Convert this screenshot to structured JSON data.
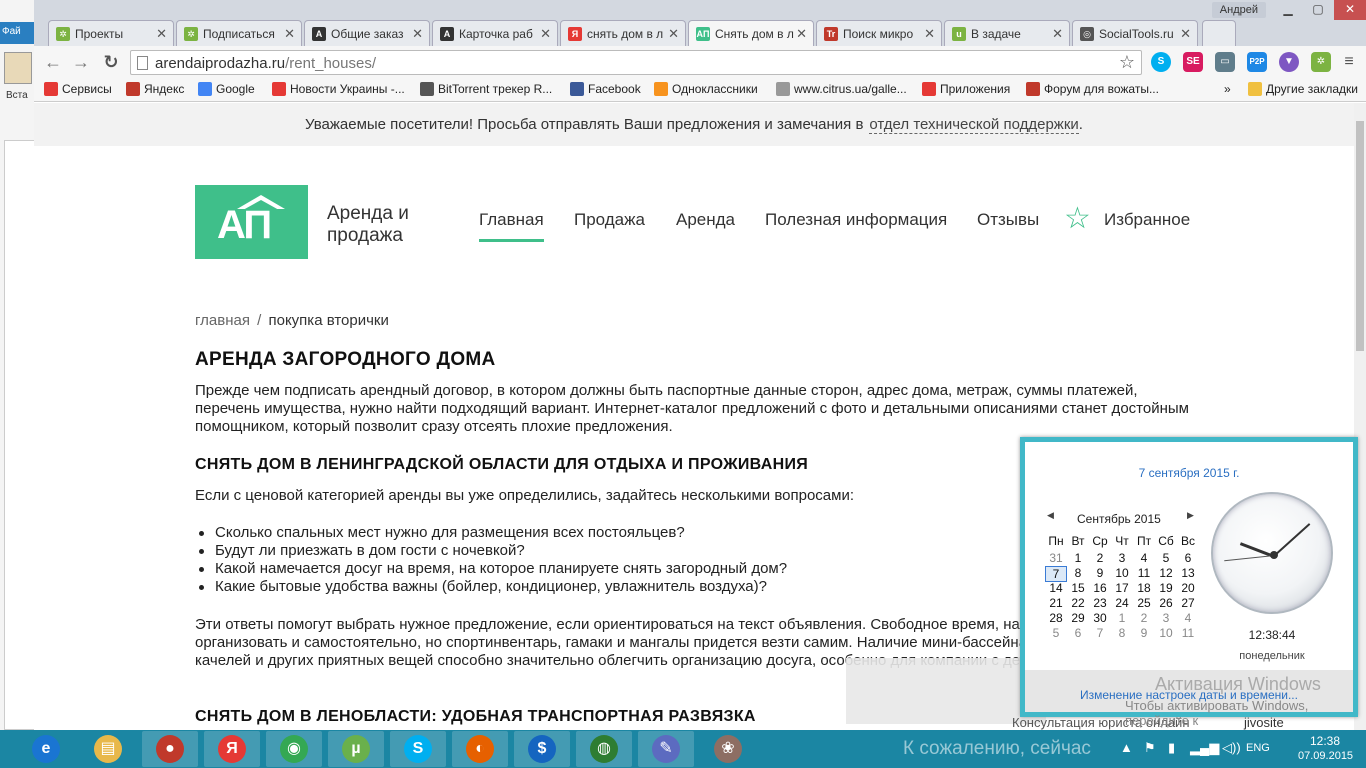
{
  "bg_app": {
    "ribbon_label": "Фай",
    "paste_label": "Вста"
  },
  "tabs": [
    {
      "title": "Проекты",
      "icon_color": "#7cb342",
      "icon_text": "✲"
    },
    {
      "title": "Подписаться",
      "icon_color": "#7cb342",
      "icon_text": "✲"
    },
    {
      "title": "Общие заказ",
      "icon_color": "#333333",
      "icon_text": "A"
    },
    {
      "title": "Карточка раб",
      "icon_color": "#333333",
      "icon_text": "A"
    },
    {
      "title": "снять дом в л",
      "icon_color": "#e53935",
      "icon_text": "Я"
    },
    {
      "title": "Снять дом в л",
      "icon_color": "#3fbf8a",
      "icon_text": "AП"
    },
    {
      "title": "Поиск микро",
      "icon_color": "#c0392b",
      "icon_text": "Tr"
    },
    {
      "title": "В задаче",
      "icon_color": "#7cb342",
      "icon_text": "u"
    },
    {
      "title": "SocialTools.ru",
      "icon_color": "#555555",
      "icon_text": "◎"
    }
  ],
  "user_name": "Андрей",
  "address_bar": {
    "domain": "arendaiprodazha.ru",
    "path": "/rent_houses/"
  },
  "bookmarks": [
    {
      "label": "Сервисы",
      "icon_color": "#e53935"
    },
    {
      "label": "Яндекс",
      "icon_color": "#c0392b"
    },
    {
      "label": "Google",
      "icon_color": "#4285f4"
    },
    {
      "label": "Новости Украины -...",
      "icon_color": "#e53935"
    },
    {
      "label": "BitTorrent трекер R...",
      "icon_color": "#555555"
    },
    {
      "label": "Facebook",
      "icon_color": "#3b5998"
    },
    {
      "label": "Одноклассники",
      "icon_color": "#f7931e"
    },
    {
      "label": "www.citrus.ua/galle...",
      "icon_color": "#999999"
    },
    {
      "label": "Приложения",
      "icon_color": "#e53935"
    },
    {
      "label": "Форум для вожаты...",
      "icon_color": "#c0392b"
    }
  ],
  "bookmarks_more": "»",
  "other_bookmarks": "Другие закладки",
  "site": {
    "notice_text": "Уважаемые посетители! Просьба отправлять Ваши предложения и замечания в",
    "notice_link": "отдел технической поддержки",
    "notice_end": ".",
    "logo_text": "АП",
    "site_name": "Аренда и продажа",
    "nav": [
      {
        "label": "Главная",
        "active": true
      },
      {
        "label": "Продажа",
        "active": false
      },
      {
        "label": "Аренда",
        "active": false
      },
      {
        "label": "Полезная информация",
        "active": false
      },
      {
        "label": "Отзывы",
        "active": false
      }
    ],
    "favorites_label": "Избранное",
    "breadcrumb_home": "главная",
    "breadcrumb_sep": "/",
    "breadcrumb_current": "покупка вторички",
    "h1": "АРЕНДА ЗАГОРОДНОГО ДОМА",
    "p1": "Прежде чем подписать арендный договор, в котором должны быть паспортные данные сторон, адрес дома, метраж, суммы платежей, перечень имущества, нужно найти подходящий вариант. Интернет-каталог предложений с фото и детальными описаниями станет достойным помощником, который позволит сразу отсеять плохие предложения.",
    "h2a": "СНЯТЬ ДОМ В ЛЕНИНГРАДСКОЙ ОБЛАСТИ ДЛЯ ОТДЫХА И ПРОЖИВАНИЯ",
    "p2": "Если с ценовой категорией аренды вы уже определились, задайтесь несколькими вопросами:",
    "list": [
      "Сколько спальных мест нужно для размещения всех постояльцев?",
      "Будут ли приезжать в дом гости с ночевкой?",
      "Какой намечается досуг на время, на которое планируете снять загородный дом?",
      "Какие бытовые удобства важны (бойлер, кондиционер, увлажнитель воздуха)?"
    ],
    "p3": "Эти ответы помогут выбрать нужное предложение, если ориентироваться на текст объявления. Свободное время, например, можно организовать и самостоятельно, но спортинвентарь, гамаки и мангалы придется везти самим. Наличие мини-бассейна, кольца для баскетбола, качелей и других приятных вещей способно значительно облегчить организацию досуга, особенно для компании с детками.",
    "h2b": "СНЯТЬ ДОМ В ЛЕНОБЛАСТИ: УДОБНАЯ ТРАНСПОРТНАЯ РАЗВЯЗКА"
  },
  "calendar": {
    "full_date": "7 сентября 2015 г.",
    "month_label": "Сентябрь 2015",
    "weekdays": [
      "Пн",
      "Вт",
      "Ср",
      "Чт",
      "Пт",
      "Сб",
      "Вс"
    ],
    "weeks": [
      [
        "31",
        "1",
        "2",
        "3",
        "4",
        "5",
        "6"
      ],
      [
        "7",
        "8",
        "9",
        "10",
        "11",
        "12",
        "13"
      ],
      [
        "14",
        "15",
        "16",
        "17",
        "18",
        "19",
        "20"
      ],
      [
        "21",
        "22",
        "23",
        "24",
        "25",
        "26",
        "27"
      ],
      [
        "28",
        "29",
        "30",
        "1",
        "2",
        "3",
        "4"
      ],
      [
        "5",
        "6",
        "7",
        "8",
        "9",
        "10",
        "11"
      ]
    ],
    "time": "12:38:44",
    "weekday_name": "понедельник",
    "watermark_1": "Активация Windows",
    "watermark_2": "Чтобы активировать Windows, перейдите к",
    "settings_link": "Изменение настроек даты и времени..."
  },
  "jivosite": {
    "consult": "Консультация юриста онлайн",
    "brand": "jivosite",
    "chat_text": "К сожалению, сейчас"
  },
  "taskbar": {
    "apps": [
      {
        "name": "ie",
        "color": "#1a75d2",
        "text": "e"
      },
      {
        "name": "explorer",
        "color": "#e8b84a",
        "text": "▤"
      },
      {
        "name": "media",
        "color": "#c0392b",
        "text": "●"
      },
      {
        "name": "yandex",
        "color": "#e53935",
        "text": "Я"
      },
      {
        "name": "chrome",
        "color": "#34a853",
        "text": "◉"
      },
      {
        "name": "utorrent",
        "color": "#6ab04c",
        "text": "µ"
      },
      {
        "name": "skype",
        "color": "#00aff0",
        "text": "S"
      },
      {
        "name": "firefox",
        "color": "#e66000",
        "text": "◐"
      },
      {
        "name": "money",
        "color": "#1565c0",
        "text": "$"
      },
      {
        "name": "globe",
        "color": "#2e7d32",
        "text": "◍"
      },
      {
        "name": "paint",
        "color": "#5c6bc0",
        "text": "✎"
      },
      {
        "name": "palette",
        "color": "#8d6e63",
        "text": "❀"
      }
    ],
    "lang": "ENG",
    "clock_time": "12:38",
    "clock_date": "07.09.2015"
  }
}
